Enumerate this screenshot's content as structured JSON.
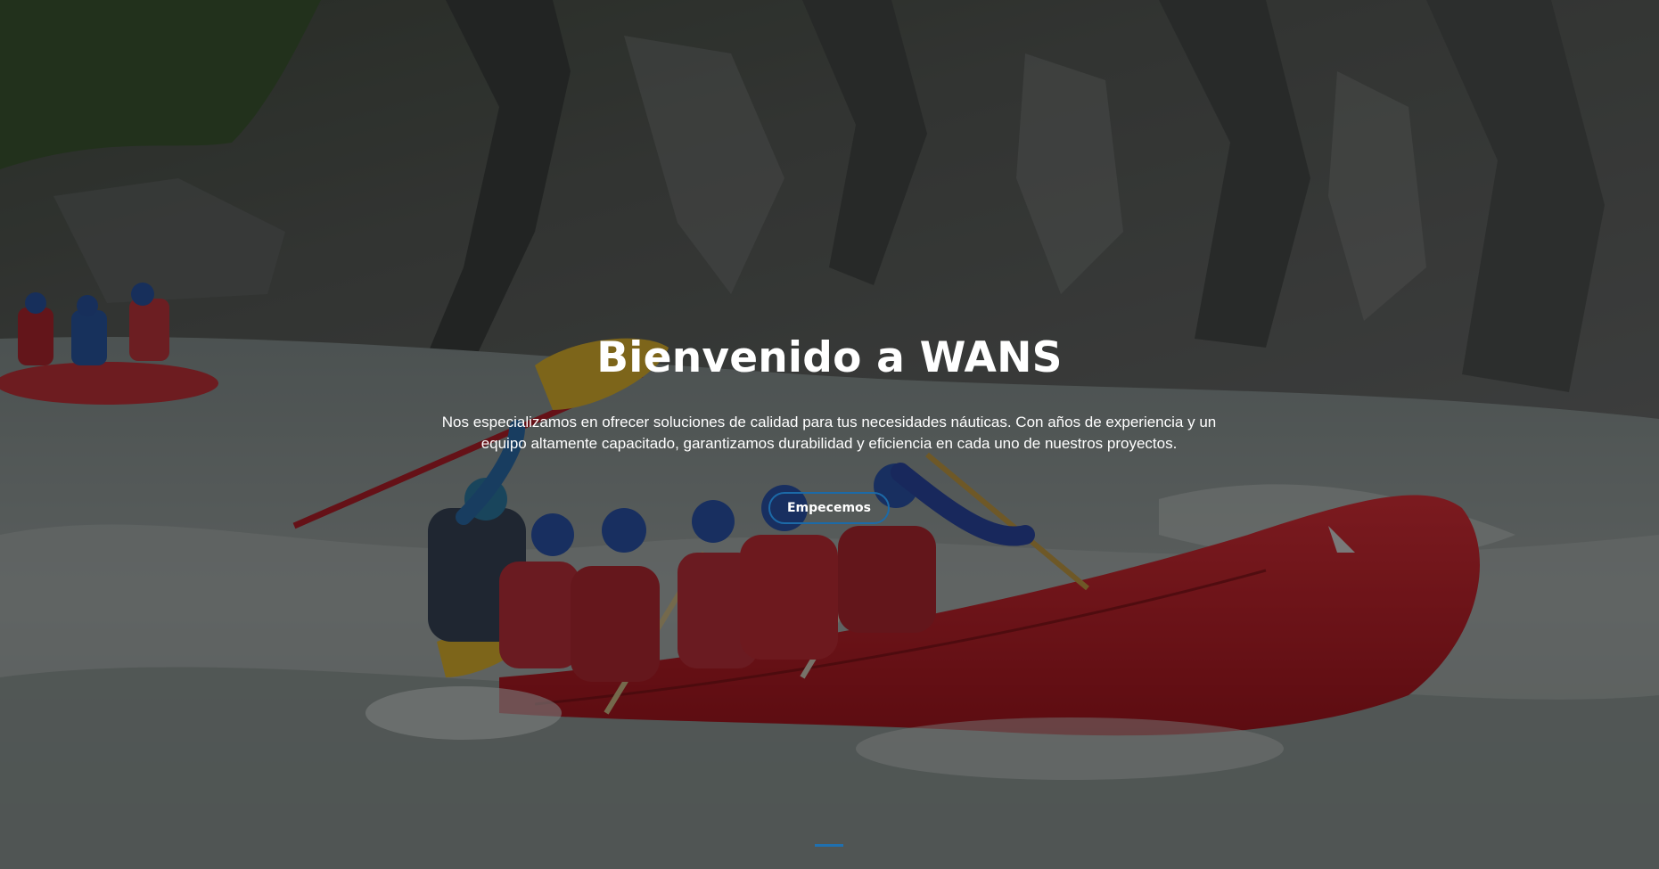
{
  "hero": {
    "title": "Bienvenido a WANS",
    "description": "Nos especializamos en ofrecer soluciones de calidad para tus necesidades náuticas. Con años de experiencia y un equipo altamente capacitado, garantizamos durabilidad y eficiencia en cada uno de nuestros proyectos.",
    "cta_label": "Empecemos",
    "background_image": "whitewater-rafting-photo",
    "accent_color": "#1f70b0",
    "carousel_indicator_count": 1,
    "carousel_active_index": 0
  }
}
